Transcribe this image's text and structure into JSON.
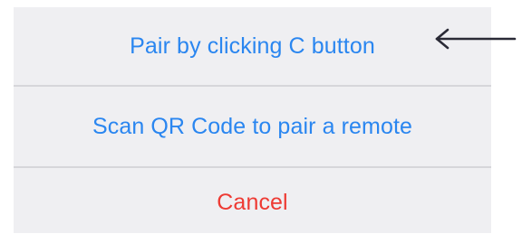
{
  "action_sheet": {
    "options": [
      {
        "label": "Pair by clicking C button",
        "color": "#2a86f0"
      },
      {
        "label": "Scan QR Code to pair a remote",
        "color": "#2a86f0"
      },
      {
        "label": "Cancel",
        "color": "#ee3a33"
      }
    ]
  },
  "annotation": {
    "icon": "left-arrow-icon",
    "color": "#2a2a36"
  },
  "colors": {
    "sheet_background": "#efeff2",
    "divider": "#d6d6da",
    "page_background": "#ffffff"
  }
}
